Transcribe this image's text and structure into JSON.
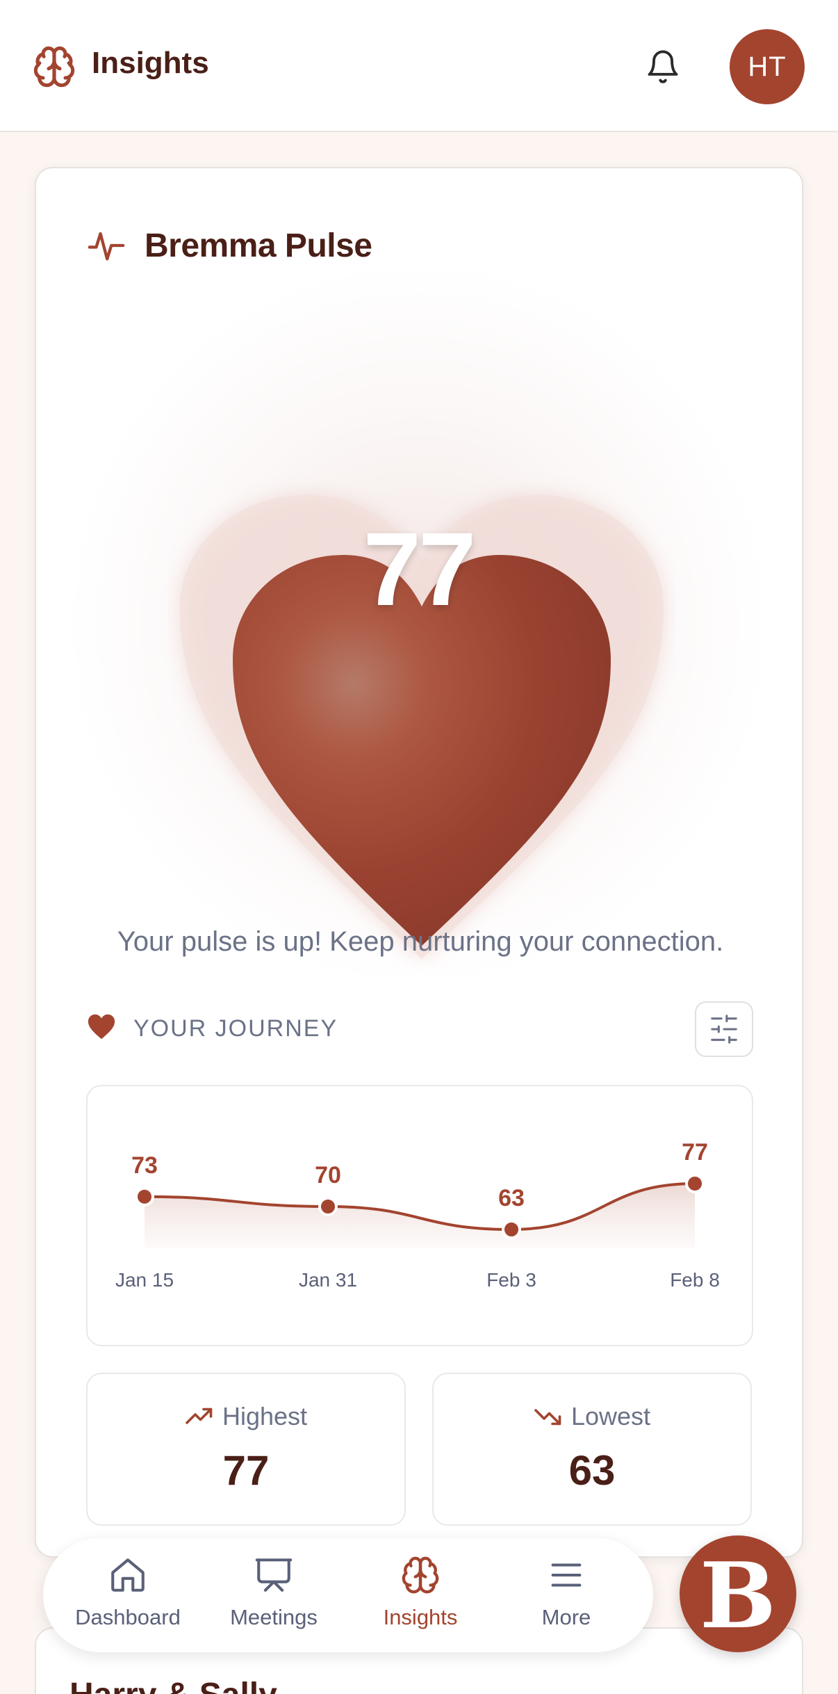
{
  "header": {
    "title": "Insights",
    "brain_icon": "brain-icon",
    "bell_icon": "bell-icon",
    "avatar_initials": "HT"
  },
  "pulse_card": {
    "title": "Bremma Pulse",
    "title_icon": "pulse-icon",
    "score": "77",
    "message": "Your pulse is up! Keep nurturing your connection."
  },
  "journey": {
    "label": "YOUR JOURNEY",
    "icon": "heart-icon",
    "filter_icon": "sliders-icon"
  },
  "chart_data": {
    "type": "line",
    "x": [
      "Jan 15",
      "Jan 31",
      "Feb 3",
      "Feb 8"
    ],
    "series": [
      {
        "values": [
          73,
          70,
          63,
          77
        ]
      }
    ]
  },
  "stats": {
    "highest": {
      "label": "Highest",
      "value": "77",
      "icon": "trending-up-icon"
    },
    "lowest": {
      "label": "Lowest",
      "value": "63",
      "icon": "trending-down-icon"
    }
  },
  "next_card": {
    "title": "Harry & Sally"
  },
  "nav": {
    "items": [
      {
        "label": "Dashboard",
        "icon": "home-icon"
      },
      {
        "label": "Meetings",
        "icon": "presentation-icon"
      },
      {
        "label": "Insights",
        "icon": "brain-icon"
      },
      {
        "label": "More",
        "icon": "menu-icon"
      }
    ],
    "active": "Insights"
  },
  "fab": {
    "letter": "B"
  },
  "colors": {
    "accent": "#a3442f",
    "text_dark": "#4a1f17",
    "text_muted": "#6b7287",
    "background": "#fcf5f1"
  }
}
